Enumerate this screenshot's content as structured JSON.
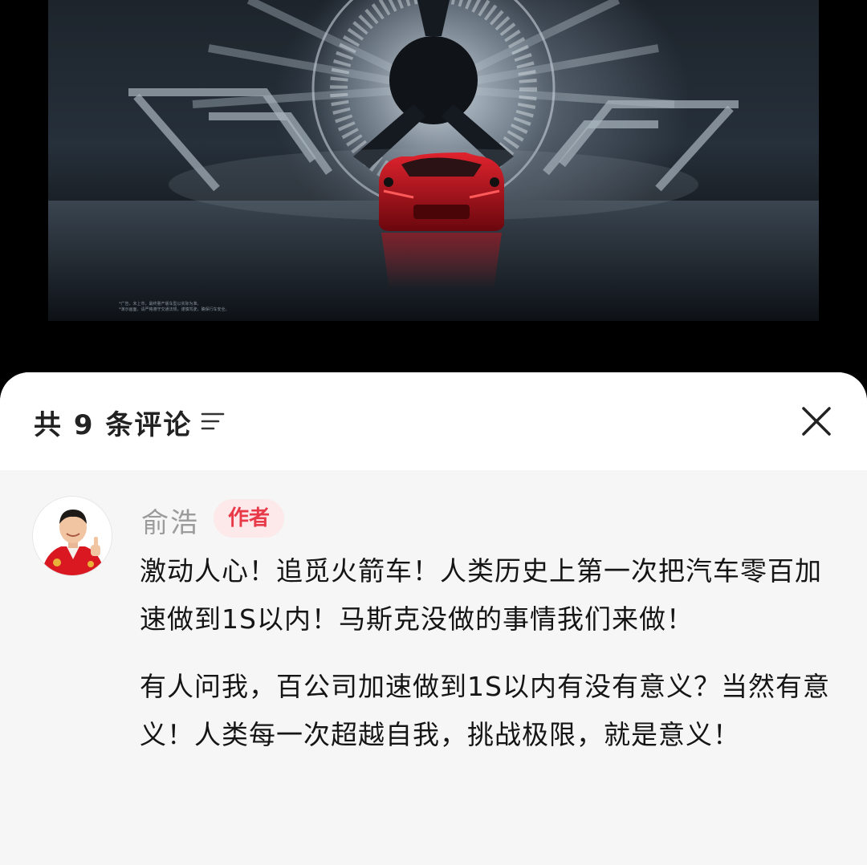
{
  "media": {
    "disclaimer_line1": "*广告，未上市，最终量产版车型以实际为准。",
    "disclaimer_line2": "*演示画面，请严格遵守交通法规，谨慎驾驶，确保行车安全。"
  },
  "comments": {
    "title": "共 9 条评论",
    "sort_icon": "sort-lines-icon",
    "close_icon": "close-x-icon",
    "items": [
      {
        "author": "俞浩",
        "badge": "作者",
        "paragraphs": [
          "激动人心！追觅火箭车！人类历史上第一次把汽车零百加速做到1S以内！马斯克没做的事情我们来做！",
          "有人问我，百公司加速做到1S以内有没有意义？当然有意义！人类每一次超越自我，挑战极限，就是意义！"
        ]
      }
    ]
  },
  "colors": {
    "badge_text": "#e83a48",
    "badge_bg": "#fde8ea",
    "author_name": "#9b9b9b",
    "body_text": "#151515",
    "car_red": "#c8101c"
  }
}
